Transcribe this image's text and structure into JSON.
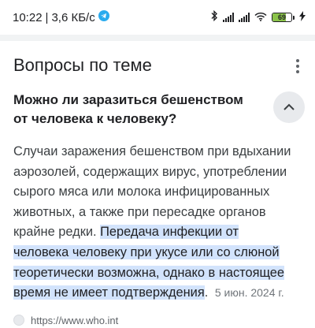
{
  "status_bar": {
    "time": "10:22",
    "separator": "|",
    "network_speed": "3,6 КБ/с",
    "battery_level": "69",
    "battery_fraction": 0.69,
    "icons": [
      "telegram-icon",
      "bluetooth-icon",
      "signal-icon",
      "signal-icon",
      "wifi-icon",
      "battery-icon",
      "charging-icon"
    ]
  },
  "section": {
    "title": "Вопросы по теме"
  },
  "question": {
    "text": "Можно ли заразиться бешенством от человека к человеку?"
  },
  "answer": {
    "plain_text": "Случаи заражения бешенством при вдыхании аэрозолей, содержащих вирус, употреблении сырого мяса или молока инфицированных животных, а также при пересадке органов крайне редки. ",
    "highlighted_text": "Передача инфекции от человека человеку при укусе или со слюной теоретически возможна, однако в настоящее время не имеет подтверждения",
    "trailing": ".",
    "date": "5 июн. 2024 г."
  },
  "source": {
    "url": "https://www.who.int"
  },
  "colors": {
    "highlight": "#d2e3fc",
    "battery": "#8bc34a",
    "collapse_button_bg": "#e8eaed"
  }
}
